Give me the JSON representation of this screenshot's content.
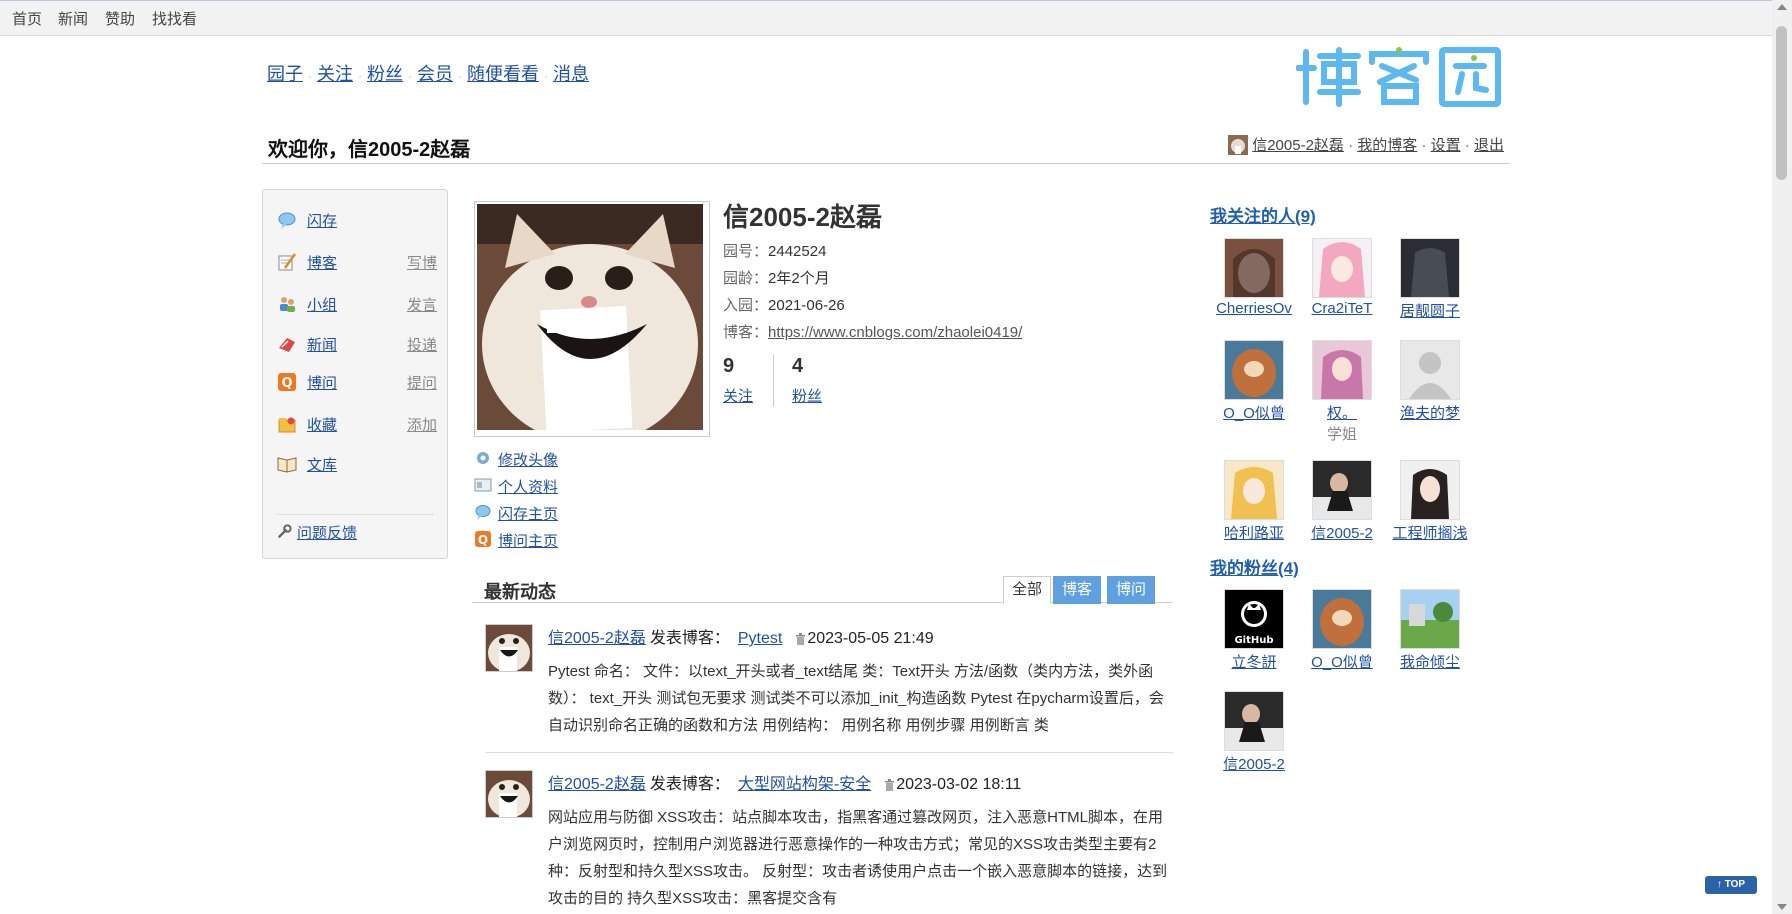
{
  "topbar": {
    "items": [
      "首页",
      "新闻",
      "赞助",
      "找找看"
    ]
  },
  "nav": {
    "items": [
      "园子",
      "关注",
      "粉丝",
      "会员",
      "随便看看",
      "消息"
    ]
  },
  "logo": {
    "text": "博客园"
  },
  "welcome": {
    "title": "欢迎你，信2005-2赵磊",
    "user_link": "信2005-2赵磊",
    "my_blog": "我的博客",
    "settings": "设置",
    "logout": "退出",
    "sep": "·"
  },
  "leftmenu": {
    "items": [
      {
        "label": "闪存",
        "icon": "chat-bubble-icon",
        "action": ""
      },
      {
        "label": "博客",
        "icon": "notepad-pencil-icon",
        "action": "写博"
      },
      {
        "label": "小组",
        "icon": "group-people-icon",
        "action": "发言"
      },
      {
        "label": "新闻",
        "icon": "news-icon",
        "action": "投递"
      },
      {
        "label": "博问",
        "icon": "q-badge-icon",
        "action": "提问"
      },
      {
        "label": "收藏",
        "icon": "folder-star-icon",
        "action": "添加"
      },
      {
        "label": "文库",
        "icon": "open-book-icon",
        "action": ""
      }
    ],
    "feedback": "问题反馈"
  },
  "profile": {
    "name": "信2005-2赵磊",
    "id_label": "园号：",
    "id_value": "2442524",
    "age_label": "园龄：",
    "age_value": "2年2个月",
    "join_label": "入园：",
    "join_value": "2021-06-26",
    "blog_label": "博客：",
    "blog_url": "https://www.cnblogs.com/zhaolei0419/",
    "following_count": "9",
    "following_label": "关注",
    "followers_count": "4",
    "followers_label": "粉丝",
    "links": [
      "修改头像",
      "个人资料",
      "闪存主页",
      "博问主页"
    ]
  },
  "feed": {
    "title": "最新动态",
    "tabs": [
      "全部",
      "博客",
      "博问"
    ],
    "items": [
      {
        "user": "信2005-2赵磊",
        "verb": "发表博客：",
        "post": "Pytest",
        "time": "2023-05-05 21:49",
        "desc": "Pytest 命名： 文件：以text_开头或者_text结尾 类：Text开头 方法/函数（类内方法，类外函数）： text_开头 测试包无要求 测试类不可以添加_init_构造函数 Pytest 在pycharm设置后，会自动识别命名正确的函数和方法 用例结构： 用例名称 用例步骤 用例断言 类"
      },
      {
        "user": "信2005-2赵磊",
        "verb": "发表博客：",
        "post": "大型网站构架-安全",
        "time": "2023-03-02 18:11",
        "desc": "网站应用与防御 XSS攻击：站点脚本攻击，指黑客通过篡改网页，注入恶意HTML脚本，在用户浏览网页时，控制用户浏览器进行恶意操作的一种攻击方式；常见的XSS攻击类型主要有2种：反射型和持久型XSS攻击。 反射型：攻击者诱使用户点击一个嵌入恶意脚本的链接，达到攻击的目的 持久型XSS攻击：黑客提交含有"
      }
    ]
  },
  "following": {
    "title": "我关注的人(9)",
    "people": [
      {
        "name": "CherriesOv",
        "sub": ""
      },
      {
        "name": "Cra2iTeT",
        "sub": ""
      },
      {
        "name": "居靓圆子",
        "sub": ""
      },
      {
        "name": "O_O似曾",
        "sub": ""
      },
      {
        "name": "权。",
        "sub": "学姐"
      },
      {
        "name": "渔夫的梦",
        "sub": ""
      },
      {
        "name": "哈利路亚",
        "sub": ""
      },
      {
        "name": "信2005-2",
        "sub": ""
      },
      {
        "name": "工程师搁浅",
        "sub": ""
      }
    ]
  },
  "followers": {
    "title": "我的粉丝(4)",
    "people": [
      {
        "name": "立冬訮",
        "sub": ""
      },
      {
        "name": "O_O似曾",
        "sub": ""
      },
      {
        "name": "我命倾尘",
        "sub": ""
      },
      {
        "name": "信2005-2",
        "sub": ""
      }
    ]
  },
  "top_button": "↑ TOP",
  "colors": {
    "link": "#2050a8",
    "accent": "#2060b0",
    "tab_inactive": "#5fa0e0",
    "logo_blue": "#5bb8f0",
    "logo_green": "#8cc63f"
  }
}
